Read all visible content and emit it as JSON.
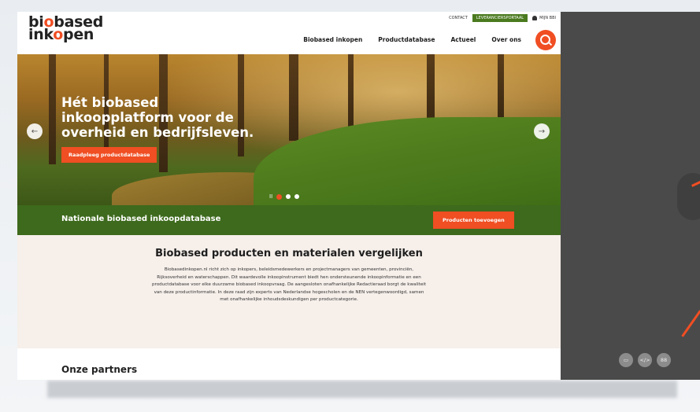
{
  "header": {
    "logo_line1": "bi",
    "logo_o1": "o",
    "logo_line1b": "based",
    "logo_line2": "ink",
    "logo_o2": "o",
    "logo_line2b": "pen",
    "contact": "CONTACT",
    "supplier_portal": "LEVERANCIERSPORTAAL",
    "account": "MIJN BBI",
    "nav": [
      "Biobased inkopen",
      "Productdatabase",
      "Actueel",
      "Over ons"
    ]
  },
  "hero": {
    "title": "Hét biobased inkoopplatform voor de overheid en bedrijfsleven.",
    "cta": "Raadpleeg productdatabase",
    "prev": "←",
    "next": "→",
    "pause": "II"
  },
  "band": {
    "title": "Nationale biobased inkoopdatabase",
    "button": "Producten toevoegen"
  },
  "intro": {
    "heading": "Biobased producten en materialen vergelijken",
    "body": "Biobasedinkopen.nl richt zich op inkopers, beleidsmedewerkers en projectmanagers van gemeenten, provinciën, Rijksoverheid en waterschappen. Dit waardevolle inkoopinstrument biedt hen ondersteunende inkoopinformatie en een productdatabase voor elke duurzame biobased inkoopvraag. De aangesloten onafhankelijke Redactieraad borgt de kwaliteit van deze productinformatie. In deze raad zijn experts van Nederlandse hogescholen en de NEN vertegenwoordigd, samen met onafhankelijke inhoudsdeskundigen per productcategorie."
  },
  "partners": {
    "heading": "Onze partners"
  },
  "tools": {
    "comment": "▭",
    "code": "</>",
    "grid": "88"
  },
  "colors": {
    "accent": "#f04e23",
    "green": "#3d6a1c",
    "panel": "#4a4a4a",
    "beige": "#f6efea"
  }
}
